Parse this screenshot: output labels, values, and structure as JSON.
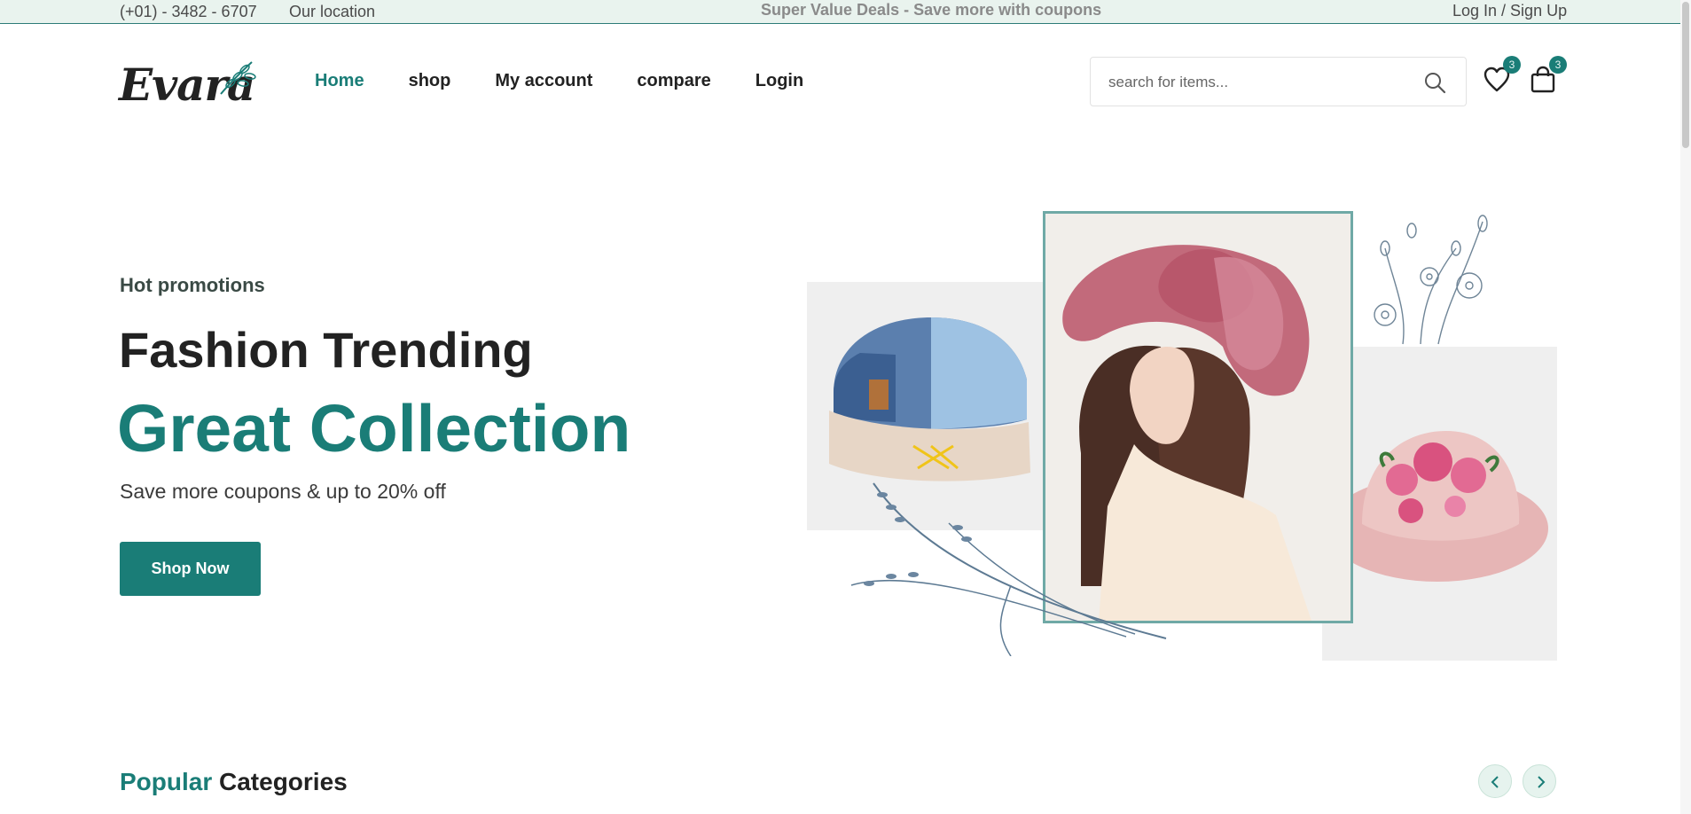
{
  "topbar": {
    "phone": "(+01) - 3482 - 6707",
    "location": "Our location",
    "deal": "Super Value Deals - Save more with coupons",
    "auth": "Log In / Sign Up"
  },
  "brand": {
    "logo_text": "Evara"
  },
  "nav": {
    "items": [
      {
        "label": "Home",
        "active": true
      },
      {
        "label": "shop"
      },
      {
        "label": "My account"
      },
      {
        "label": "compare"
      },
      {
        "label": "Login"
      }
    ]
  },
  "search": {
    "placeholder": "search for items...",
    "value": ""
  },
  "header_icons": {
    "wishlist_count": "3",
    "cart_count": "3"
  },
  "hero": {
    "eyebrow": "Hot promotions",
    "title": "Fashion Trending",
    "title_accent": "Great Collection",
    "description": "Save more coupons & up to 20% off",
    "cta": "Shop Now"
  },
  "popular": {
    "title_accent": "Popular",
    "title_rest": " Categories"
  },
  "colors": {
    "accent": "#1a7d77",
    "topbar_bg": "#e9f3ee"
  }
}
